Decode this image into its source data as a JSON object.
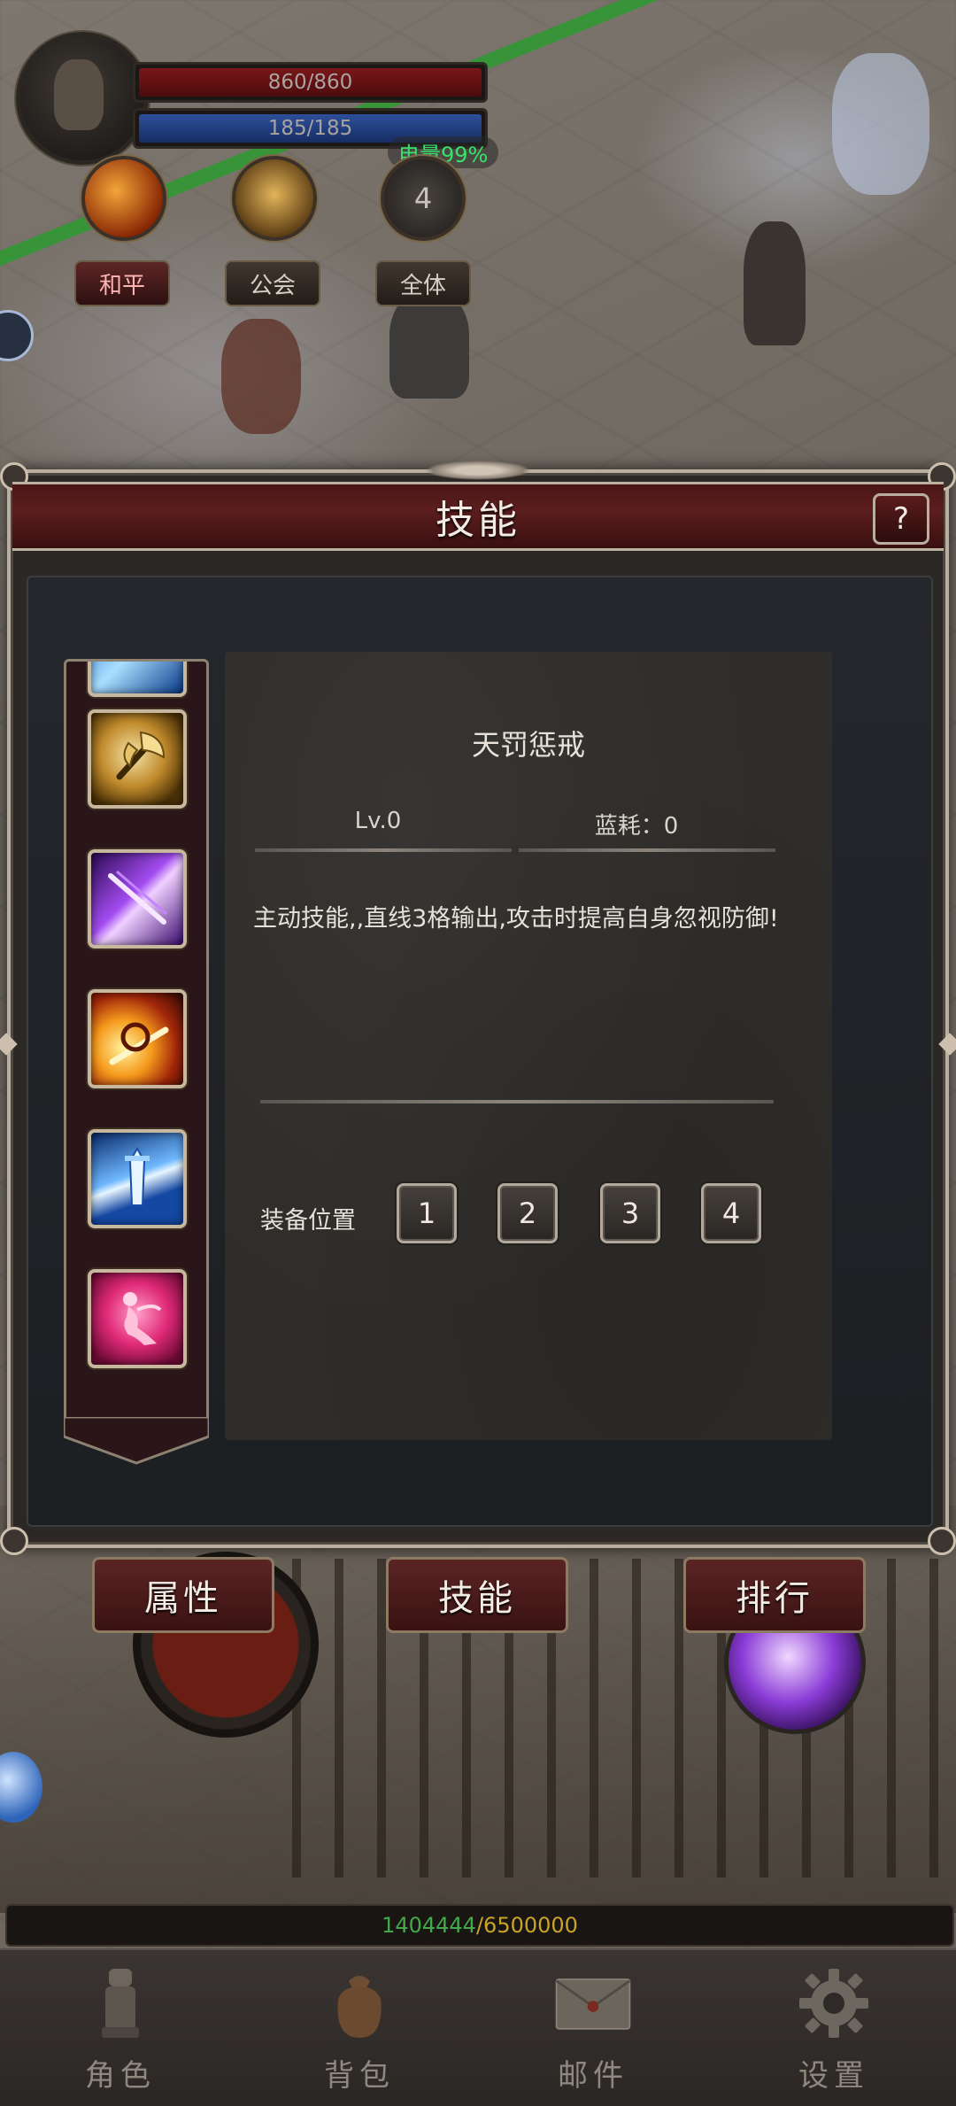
{
  "hud": {
    "hp_text": "860/860",
    "mp_text": "185/185",
    "battery": "电量99%",
    "hotkey_count": "4",
    "modes": [
      "和平",
      "公会",
      "全体"
    ]
  },
  "dialog": {
    "title": "技能",
    "help": "?",
    "skill_list": [
      {
        "name": "ice-slash-skill",
        "color": "#1d6fd1"
      },
      {
        "name": "golden-axe-skill",
        "color": "#c08a2c"
      },
      {
        "name": "purple-blade-skill",
        "color": "#a34cf0"
      },
      {
        "name": "fire-strike-skill",
        "color": "#f59a1c"
      },
      {
        "name": "ice-sword-skill",
        "color": "#6fb8ff"
      },
      {
        "name": "pink-dancer-skill",
        "color": "#e02a78"
      }
    ],
    "detail": {
      "name": "天罚惩戒",
      "level": "Lv.0",
      "cost": "蓝耗：0",
      "description": "主动技能,,直线3格输出,攻击时提高自身忽视防御!",
      "equip_label": "装备位置",
      "equip_slots": [
        "1",
        "2",
        "3",
        "4"
      ]
    }
  },
  "tabs": [
    "属性",
    "技能",
    "排行"
  ],
  "exp": {
    "current": "1404444",
    "separator": "/",
    "max": "6500000"
  },
  "nav": [
    {
      "label": "角色",
      "icon": "character-icon"
    },
    {
      "label": "背包",
      "icon": "bag-icon"
    },
    {
      "label": "邮件",
      "icon": "mail-icon"
    },
    {
      "label": "设置",
      "icon": "gear-icon"
    }
  ]
}
